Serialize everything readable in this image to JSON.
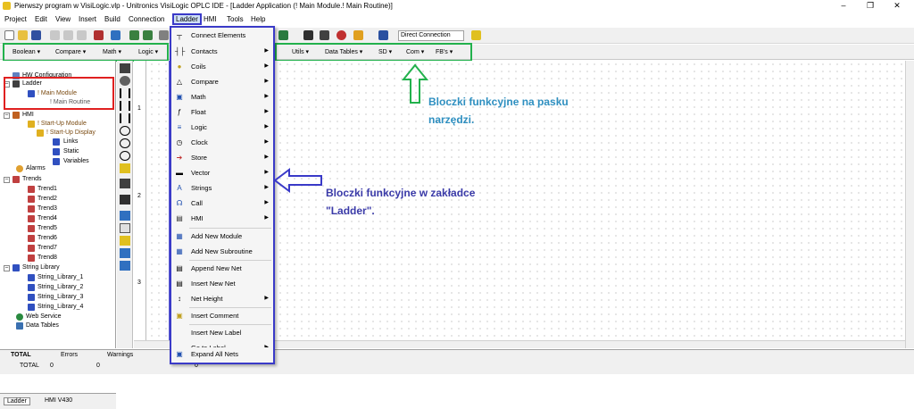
{
  "window": {
    "title": "Pierwszy program w VisiLogic.vlp - Unitronics VisiLogic OPLC IDE - [Ladder Application (! Main Module.! Main Routine)]",
    "controls": [
      "–",
      "❐",
      "✕"
    ]
  },
  "menubar": [
    "Project",
    "Edit",
    "View",
    "Insert",
    "Build",
    "Connection",
    "Ladder",
    "HMI",
    "Tools",
    "Help"
  ],
  "toolbar": {
    "connection": "Direct Connection"
  },
  "function_toolbar": [
    "Boolean",
    "Compare",
    "Math",
    "Logic",
    "Utils",
    "Data Tables",
    "SD",
    "Com",
    "FB's"
  ],
  "tree": {
    "hw": "HW Configuration",
    "ladder": "Ladder",
    "main_module": "! Main Module",
    "main_routine": "! Main Routine",
    "hmi": "HMI",
    "startup_module": "! Start-Up Module",
    "startup_display": "! Start-Up Display",
    "links": "Links",
    "static": "Static",
    "variables": "Variables",
    "alarms": "Alarms",
    "trends": "Trends",
    "trend_items": [
      "Trend1",
      "Trend2",
      "Trend3",
      "Trend4",
      "Trend5",
      "Trend6",
      "Trend7",
      "Trend8"
    ],
    "string_library": "String Library",
    "string_items": [
      "String_Library_1",
      "String_Library_2",
      "String_Library_3",
      "String_Library_4"
    ],
    "web_service": "Web Service",
    "data_tables": "Data Tables"
  },
  "sidebar_tabs": {
    "ladder": "Ladder",
    "hmi": "HMI V430"
  },
  "nets": [
    "1",
    "2",
    "3"
  ],
  "ladder_menu": {
    "connect": "Connect Elements",
    "contacts": "Contacts",
    "coils": "Coils",
    "compare": "Compare",
    "math": "Math",
    "float": "Float",
    "logic": "Logic",
    "clock": "Clock",
    "store": "Store",
    "vector": "Vector",
    "strings": "Strings",
    "call": "Call",
    "hmi": "HMI",
    "add_module": "Add New Module",
    "add_subroutine": "Add New Subroutine",
    "append_net": "Append New Net",
    "insert_net": "Insert New Net",
    "net_height": "Net Height",
    "insert_comment": "Insert Comment",
    "insert_label": "Insert New Label",
    "goto_label": "Go to Label",
    "expand_nets": "Expand All Nets"
  },
  "annotations": {
    "toolbar_note": "Bloczki funkcyjne na pasku narzędzi.",
    "menu_note": "Bloczki funkcyjne w zakładce \"Ladder\"."
  },
  "output": {
    "total_label": "TOTAL",
    "errors_label": "Errors",
    "warnings_label": "Warnings",
    "errors": "0",
    "warnings": "0",
    "extra": "0"
  },
  "colors": {
    "menu_border": "#3a3ac8",
    "toolbar_highlight": "#22b14c",
    "tree_highlight": "#e02020",
    "annotation": "#2e8fc0"
  }
}
